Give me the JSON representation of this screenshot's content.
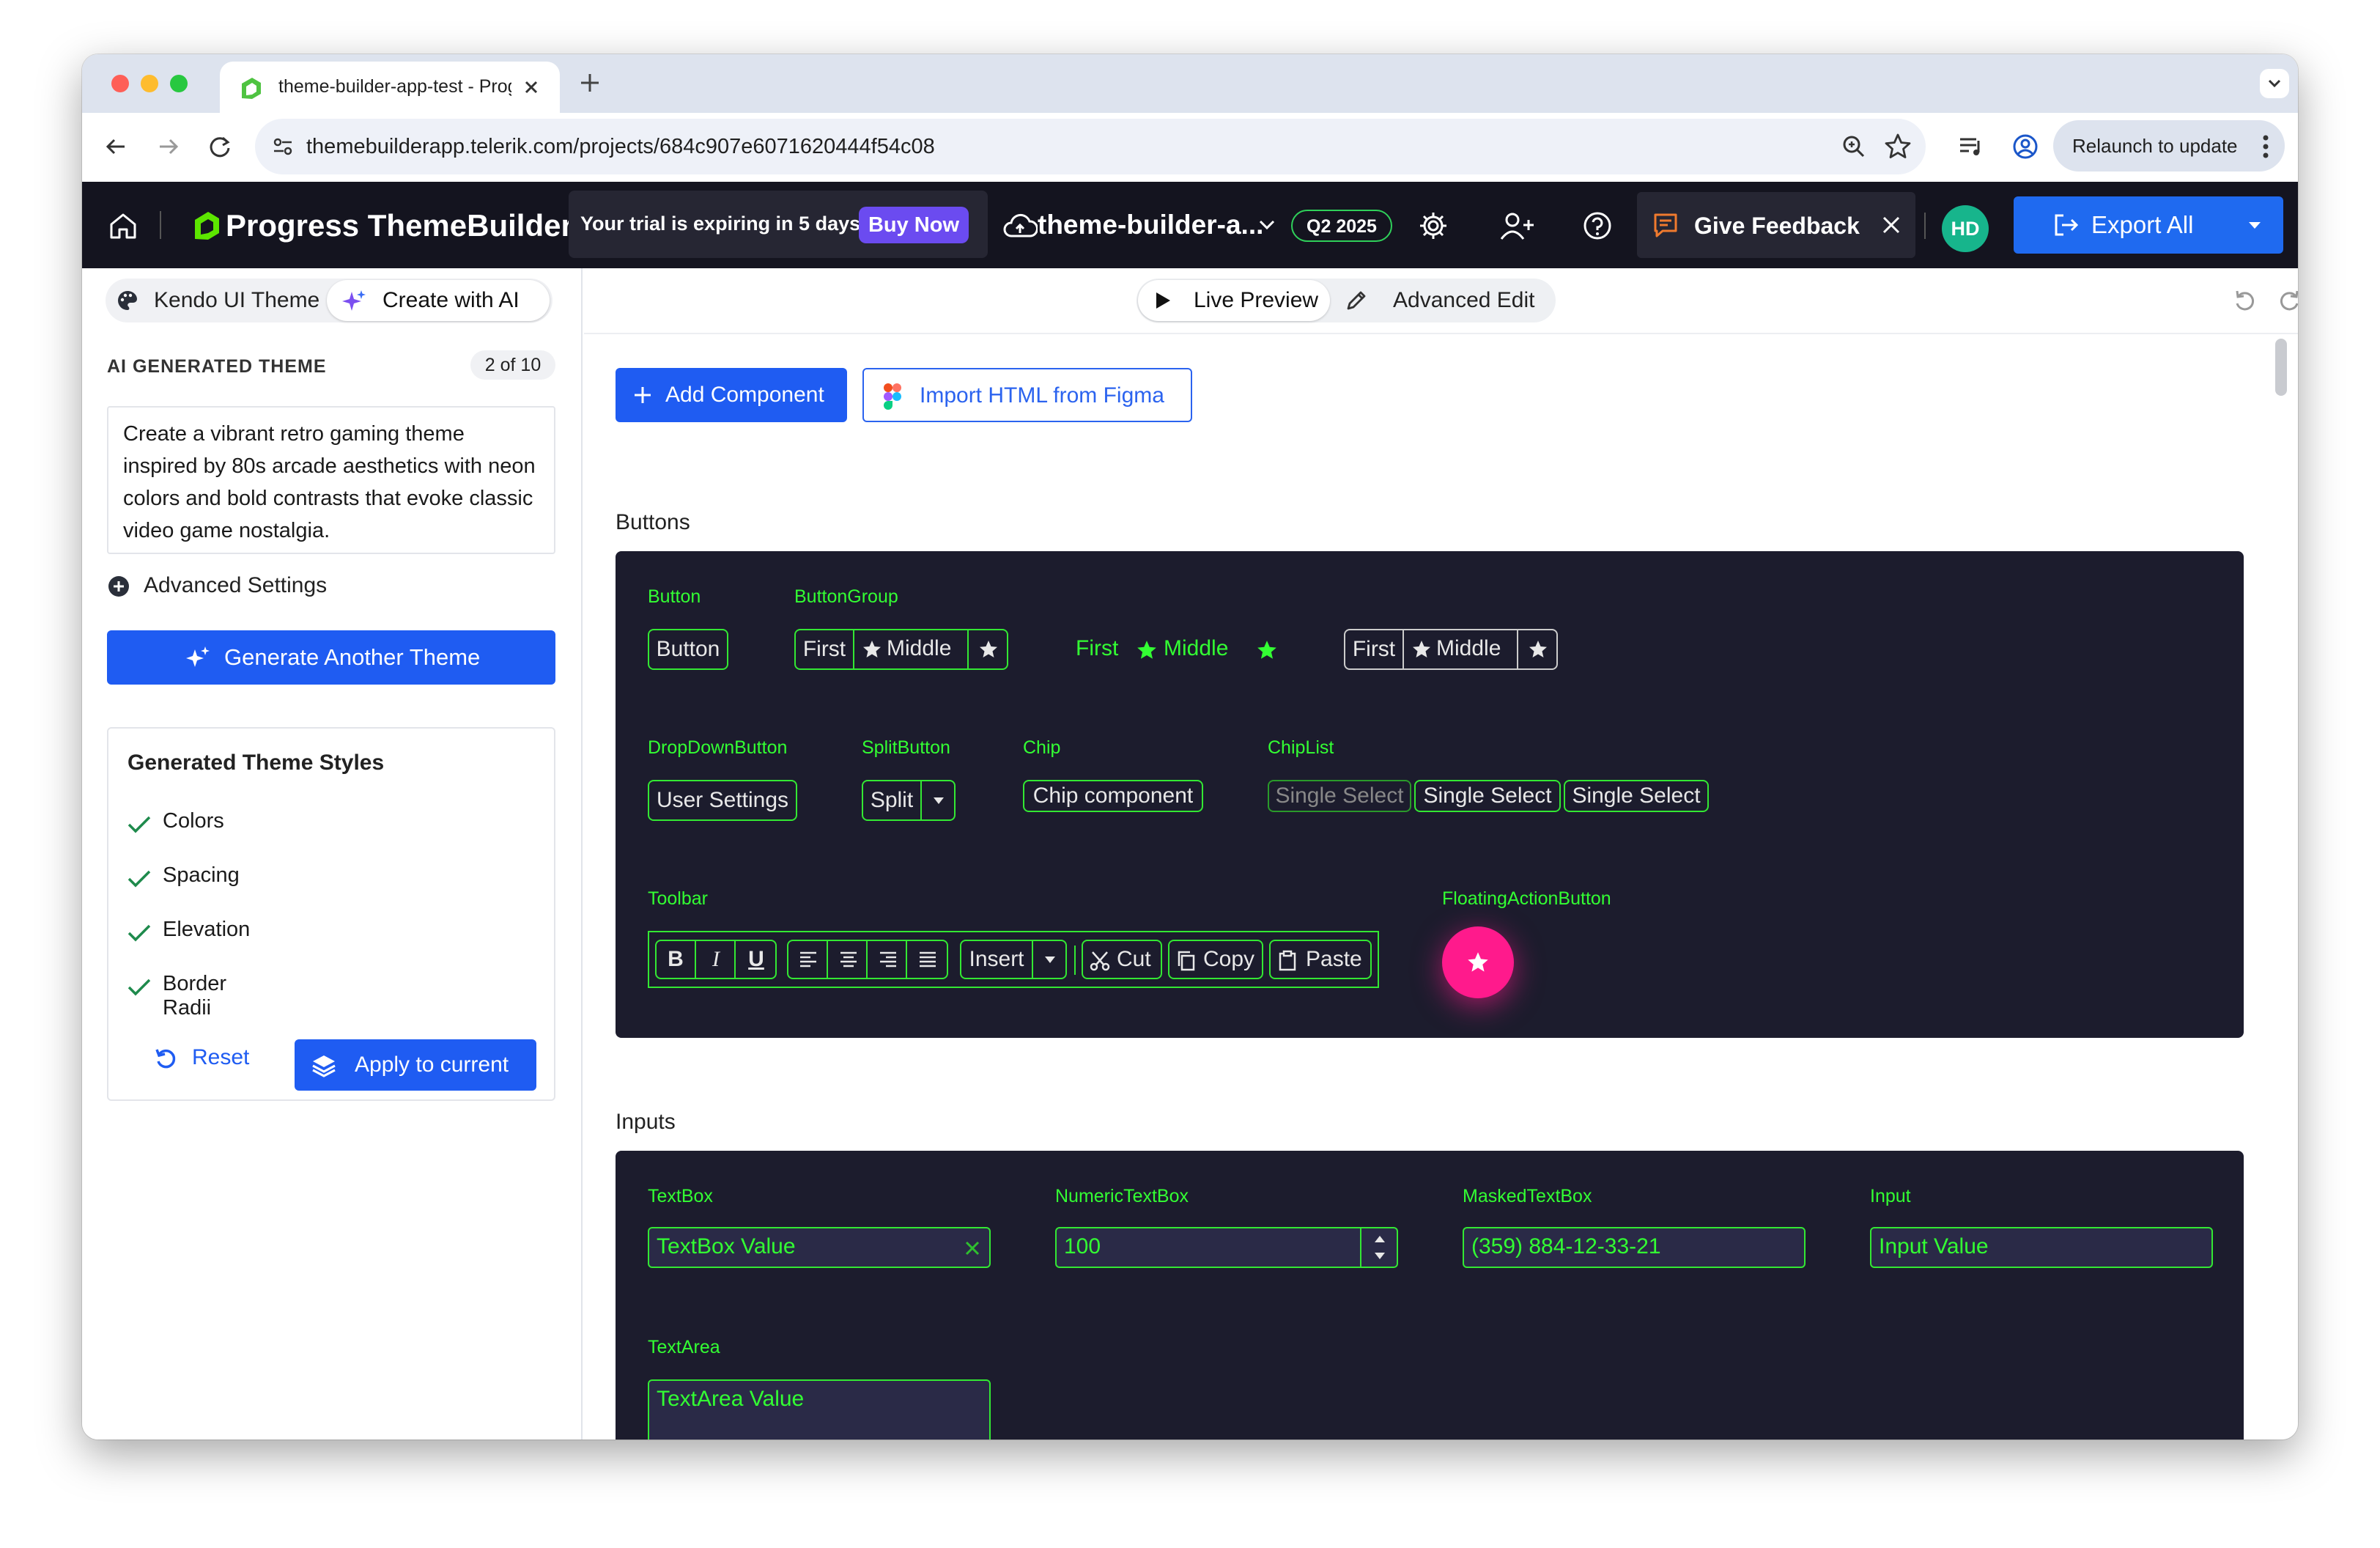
{
  "browser": {
    "tab_title": "theme-builder-app-test - Progress",
    "url": "themebuilderapp.telerik.com/projects/684c907e6071620444f54c08",
    "relaunch_label": "Relaunch to update"
  },
  "header": {
    "brand": "Progress ThemeBuilder",
    "trial_text": "Your trial is expiring in 5 days.",
    "buy_now": "Buy Now",
    "project_name": "theme-builder-a...",
    "version_badge": "Q2 2025",
    "feedback_label": "Give Feedback",
    "avatar_initials": "HD",
    "export_label": "Export All"
  },
  "sidebar": {
    "tab_kendo": "Kendo UI Theme",
    "tab_ai": "Create with AI",
    "section_title": "AI GENERATED THEME",
    "counter": "2 of 10",
    "prompt_text": "Create a vibrant retro gaming theme inspired by 80s arcade aesthetics with neon colors and bold contrasts that evoke classic video game nostalgia.",
    "advanced_settings": "Advanced Settings",
    "generate_button": "Generate Another Theme",
    "styles_title": "Generated Theme Styles",
    "styles": [
      "Colors",
      "Spacing",
      "Elevation",
      "Border Radii"
    ],
    "reset": "Reset",
    "apply": "Apply to current"
  },
  "toolbar": {
    "live_preview": "Live Preview",
    "advanced_edit": "Advanced Edit",
    "add_component": "Add Component",
    "import_figma": "Import HTML from Figma"
  },
  "buttons_section": {
    "title": "Buttons",
    "button_label": "Button",
    "button_text": "Button",
    "buttongroup_label": "ButtonGroup",
    "first": "First",
    "middle": "Middle",
    "dropdown_label": "DropDownButton",
    "dropdown_text": "User Settings",
    "split_label": "SplitButton",
    "split_text": "Split",
    "chip_label": "Chip",
    "chip_text": "Chip component",
    "chiplist_label": "ChipList",
    "chiplist_items": [
      "Single Select",
      "Single Select",
      "Single Select"
    ],
    "toolbar_label": "Toolbar",
    "toolbar_insert": "Insert",
    "toolbar_cut": "Cut",
    "toolbar_copy": "Copy",
    "toolbar_paste": "Paste",
    "fab_label": "FloatingActionButton"
  },
  "inputs_section": {
    "title": "Inputs",
    "textbox_label": "TextBox",
    "textbox_value": "TextBox Value",
    "numeric_label": "NumericTextBox",
    "numeric_value": "100",
    "masked_label": "MaskedTextBox",
    "masked_value": "(359) 884-12-33-21",
    "input_label": "Input",
    "input_value": "Input Value",
    "textarea_label": "TextArea",
    "textarea_value": "TextArea Value"
  },
  "colors": {
    "neon_green": "#33ff33",
    "panel_bg": "#1c1c2d",
    "fab_pink": "#ff1a8c",
    "primary_blue": "#1f5cf2",
    "header_bg": "#14141f"
  }
}
